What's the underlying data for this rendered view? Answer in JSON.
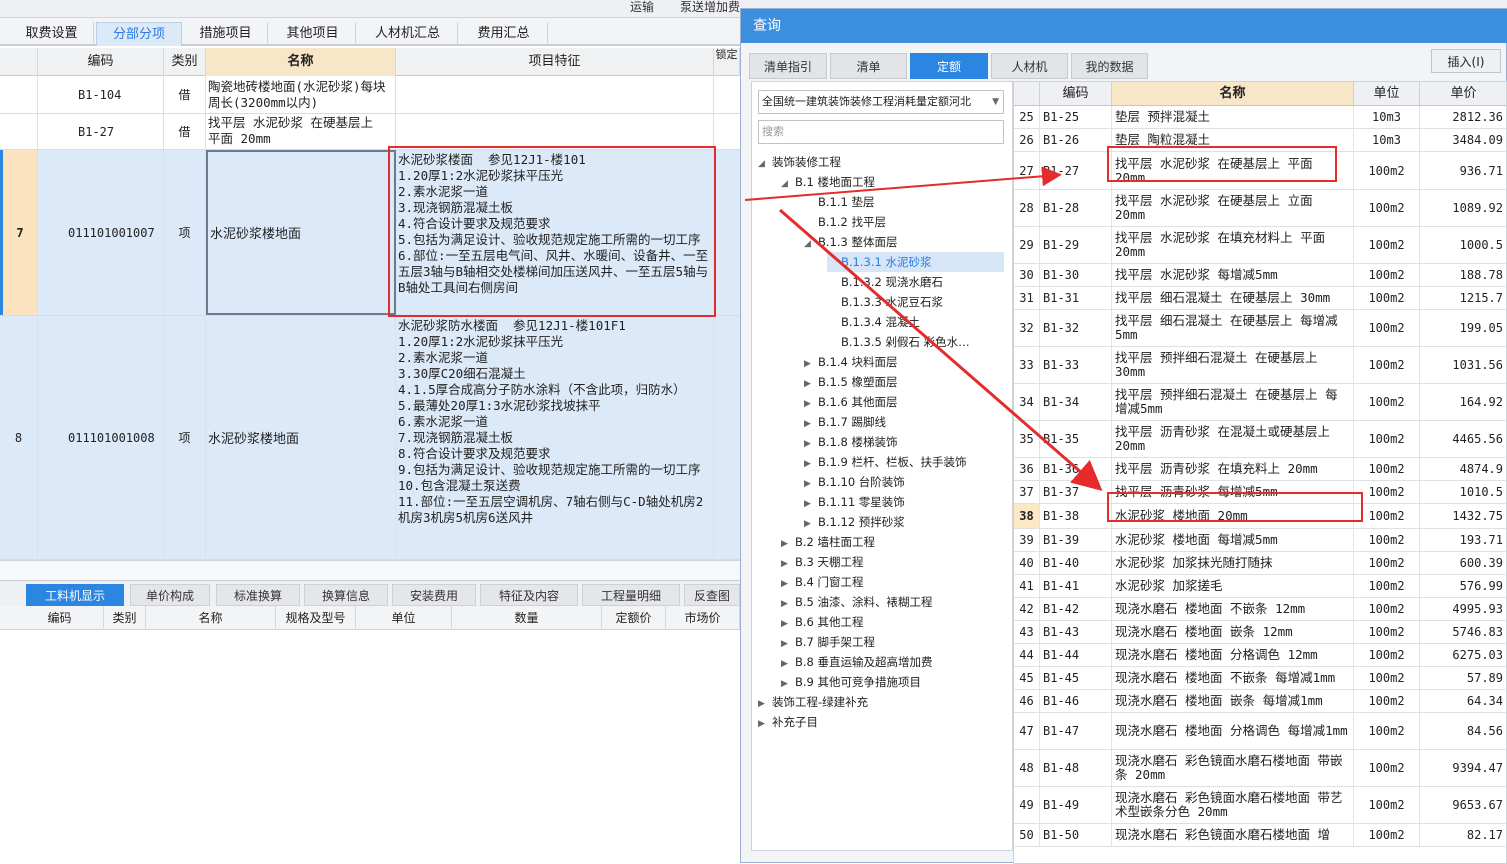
{
  "topstrip": {
    "a": "运输",
    "b": "泵送增加费"
  },
  "tabs": [
    "取费设置",
    "分部分项",
    "措施项目",
    "其他项目",
    "人材机汇总",
    "费用汇总"
  ],
  "grid": {
    "headers": {
      "code": "编码",
      "type": "类别",
      "name": "名称",
      "feature": "项目特征",
      "lock": "锁定"
    },
    "rows": [
      {
        "num": "",
        "code": "B1-104",
        "type": "借",
        "name": "陶瓷地砖楼地面(水泥砂浆)每块周长(3200mm以内)",
        "feature": ""
      },
      {
        "num": "",
        "code": "B1-27",
        "type": "借",
        "name": "找平层 水泥砂浆 在硬基层上 平面 20mm",
        "feature": ""
      },
      {
        "num": "7",
        "code": "011101001007",
        "type": "项",
        "name": "水泥砂浆楼地面",
        "feature": "水泥砂浆楼面  参见12J1-楼101\n1.20厚1:2水泥砂浆抹平压光\n2.素水泥浆一道\n3.现浇钢筋混凝土板\n4.符合设计要求及规范要求\n5.包括为满足设计、验收规范规定施工所需的一切工序\n6.部位:一至五层电气间、风井、水暖间、设备井、一至五层3轴与B轴相交处楼梯间加压送风井、一至五层5轴与B轴处工具间右侧房间"
      },
      {
        "num": "8",
        "code": "011101001008",
        "type": "项",
        "name": "水泥砂浆楼地面",
        "feature": "水泥砂浆防水楼面  参见12J1-楼101F1\n1.20厚1:2水泥砂浆抹平压光\n2.素水泥浆一道\n3.30厚C20细石混凝土\n4.1.5厚合成高分子防水涂料（不含此项，归防水）\n5.最薄处20厚1:3水泥砂浆找坡抹平\n6.素水泥浆一道\n7.现浇钢筋混凝土板\n8.符合设计要求及规范要求\n9.包括为满足设计、验收规范规定施工所需的一切工序\n10.包含混凝土泵送费\n11.部位:一至五层空调机房、7轴右侧与C-D轴处机房2机房3机房5机房6送风井"
      }
    ]
  },
  "bottom": {
    "tabs": [
      "工料机显示",
      "单价构成",
      "标准换算",
      "换算信息",
      "安装费用",
      "特征及内容",
      "工程量明细",
      "反查图"
    ],
    "headers": [
      "编码",
      "类别",
      "名称",
      "规格及型号",
      "单位",
      "数量",
      "定额价",
      "市场价"
    ]
  },
  "dialog": {
    "title": "查询",
    "tabs": [
      "清单指引",
      "清单",
      "定额",
      "人材机",
      "我的数据"
    ],
    "insert": "插入(I)",
    "combo": "全国统一建筑装饰装修工程消耗量定额河北",
    "search_placeholder": "搜索",
    "tree": [
      {
        "label": "装饰装修工程",
        "level": 0,
        "arrow": "◢"
      },
      {
        "label": "B.1 楼地面工程",
        "level": 1,
        "arrow": "◢"
      },
      {
        "label": "B.1.1 垫层",
        "level": 2,
        "arrow": ""
      },
      {
        "label": "B.1.2 找平层",
        "level": 2,
        "arrow": ""
      },
      {
        "label": "B.1.3 整体面层",
        "level": 2,
        "arrow": "◢"
      },
      {
        "label": "B.1.3.1 水泥砂浆",
        "level": 3,
        "arrow": "",
        "hl": true
      },
      {
        "label": "B.1.3.2 现浇水磨石",
        "level": 3,
        "arrow": ""
      },
      {
        "label": "B.1.3.3 水泥豆石浆",
        "level": 3,
        "arrow": ""
      },
      {
        "label": "B.1.3.4 混凝土",
        "level": 3,
        "arrow": ""
      },
      {
        "label": "B.1.3.5 剁假石  彩色水…",
        "level": 3,
        "arrow": ""
      },
      {
        "label": "B.1.4 块料面层",
        "level": 2,
        "arrow": "▶"
      },
      {
        "label": "B.1.5 橡塑面层",
        "level": 2,
        "arrow": "▶"
      },
      {
        "label": "B.1.6 其他面层",
        "level": 2,
        "arrow": "▶"
      },
      {
        "label": "B.1.7 踢脚线",
        "level": 2,
        "arrow": "▶"
      },
      {
        "label": "B.1.8 楼梯装饰",
        "level": 2,
        "arrow": "▶"
      },
      {
        "label": "B.1.9 栏杆、栏板、扶手装饰",
        "level": 2,
        "arrow": "▶"
      },
      {
        "label": "B.1.10 台阶装饰",
        "level": 2,
        "arrow": "▶"
      },
      {
        "label": "B.1.11 零星装饰",
        "level": 2,
        "arrow": "▶"
      },
      {
        "label": "B.1.12 预拌砂浆",
        "level": 2,
        "arrow": "▶"
      },
      {
        "label": "B.2 墙柱面工程",
        "level": 1,
        "arrow": "▶"
      },
      {
        "label": "B.3 天棚工程",
        "level": 1,
        "arrow": "▶"
      },
      {
        "label": "B.4 门窗工程",
        "level": 1,
        "arrow": "▶"
      },
      {
        "label": "B.5 油漆、涂料、裱糊工程",
        "level": 1,
        "arrow": "▶"
      },
      {
        "label": "B.6 其他工程",
        "level": 1,
        "arrow": "▶"
      },
      {
        "label": "B.7 脚手架工程",
        "level": 1,
        "arrow": "▶"
      },
      {
        "label": "B.8 垂直运输及超高增加费",
        "level": 1,
        "arrow": "▶"
      },
      {
        "label": "B.9 其他可竞争措施项目",
        "level": 1,
        "arrow": "▶"
      },
      {
        "label": "装饰工程-绿建补充",
        "level": 0,
        "arrow": "▶"
      },
      {
        "label": "补充子目",
        "level": 0,
        "arrow": "▶"
      }
    ],
    "table_headers": [
      "编码",
      "名称",
      "单位",
      "单价"
    ],
    "rows": [
      {
        "i": "25",
        "code": "B1-25",
        "name": "垫层 预拌混凝土",
        "unit": "10m3",
        "price": "2812.36"
      },
      {
        "i": "26",
        "code": "B1-26",
        "name": "垫层 陶粒混凝土",
        "unit": "10m3",
        "price": "3484.09"
      },
      {
        "i": "27",
        "code": "B1-27",
        "name": "找平层 水泥砂浆 在硬基层上 平面 20mm",
        "unit": "100m2",
        "price": "936.71"
      },
      {
        "i": "28",
        "code": "B1-28",
        "name": "找平层 水泥砂浆 在硬基层上 立面 20mm",
        "unit": "100m2",
        "price": "1089.92"
      },
      {
        "i": "29",
        "code": "B1-29",
        "name": "找平层 水泥砂浆 在填充材料上 平面 20mm",
        "unit": "100m2",
        "price": "1000.5"
      },
      {
        "i": "30",
        "code": "B1-30",
        "name": "找平层 水泥砂浆 每增减5mm",
        "unit": "100m2",
        "price": "188.78"
      },
      {
        "i": "31",
        "code": "B1-31",
        "name": "找平层 细石混凝土 在硬基层上 30mm",
        "unit": "100m2",
        "price": "1215.7"
      },
      {
        "i": "32",
        "code": "B1-32",
        "name": "找平层 细石混凝土 在硬基层上 每增减5mm",
        "unit": "100m2",
        "price": "199.05"
      },
      {
        "i": "33",
        "code": "B1-33",
        "name": "找平层 预拌细石混凝土 在硬基层上 30mm",
        "unit": "100m2",
        "price": "1031.56"
      },
      {
        "i": "34",
        "code": "B1-34",
        "name": "找平层 预拌细石混凝土 在硬基层上 每增减5mm",
        "unit": "100m2",
        "price": "164.92"
      },
      {
        "i": "35",
        "code": "B1-35",
        "name": "找平层 沥青砂浆 在混凝土或硬基层上 20mm",
        "unit": "100m2",
        "price": "4465.56"
      },
      {
        "i": "36",
        "code": "B1-36",
        "name": "找平层 沥青砂浆 在填充料上 20mm",
        "unit": "100m2",
        "price": "4874.9"
      },
      {
        "i": "37",
        "code": "B1-37",
        "name": "找平层 沥青砂浆 每增减5mm",
        "unit": "100m2",
        "price": "1010.5"
      },
      {
        "i": "38",
        "code": "B1-38",
        "name": "水泥砂浆 楼地面 20mm",
        "unit": "100m2",
        "price": "1432.75"
      },
      {
        "i": "39",
        "code": "B1-39",
        "name": "水泥砂浆 楼地面 每增减5mm",
        "unit": "100m2",
        "price": "193.71"
      },
      {
        "i": "40",
        "code": "B1-40",
        "name": "水泥砂浆 加浆抹光随打随抹",
        "unit": "100m2",
        "price": "600.39"
      },
      {
        "i": "41",
        "code": "B1-41",
        "name": "水泥砂浆 加浆搓毛",
        "unit": "100m2",
        "price": "576.99"
      },
      {
        "i": "42",
        "code": "B1-42",
        "name": "现浇水磨石 楼地面 不嵌条 12mm",
        "unit": "100m2",
        "price": "4995.93"
      },
      {
        "i": "43",
        "code": "B1-43",
        "name": "现浇水磨石 楼地面 嵌条 12mm",
        "unit": "100m2",
        "price": "5746.83"
      },
      {
        "i": "44",
        "code": "B1-44",
        "name": "现浇水磨石 楼地面 分格调色 12mm",
        "unit": "100m2",
        "price": "6275.03"
      },
      {
        "i": "45",
        "code": "B1-45",
        "name": "现浇水磨石 楼地面 不嵌条 每增减1mm",
        "unit": "100m2",
        "price": "57.89"
      },
      {
        "i": "46",
        "code": "B1-46",
        "name": "现浇水磨石 楼地面 嵌条 每增减1mm",
        "unit": "100m2",
        "price": "64.34"
      },
      {
        "i": "47",
        "code": "B1-47",
        "name": "现浇水磨石 楼地面 分格调色 每增减1mm",
        "unit": "100m2",
        "price": "84.56"
      },
      {
        "i": "48",
        "code": "B1-48",
        "name": "现浇水磨石 彩色镜面水磨石楼地面 带嵌条 20mm",
        "unit": "100m2",
        "price": "9394.47"
      },
      {
        "i": "49",
        "code": "B1-49",
        "name": "现浇水磨石 彩色镜面水磨石楼地面 带艺术型嵌条分色 20mm",
        "unit": "100m2",
        "price": "9653.67"
      },
      {
        "i": "50",
        "code": "B1-50",
        "name": "现浇水磨石 彩色镜面水磨石楼地面 增",
        "unit": "100m2",
        "price": "82.17"
      }
    ]
  }
}
